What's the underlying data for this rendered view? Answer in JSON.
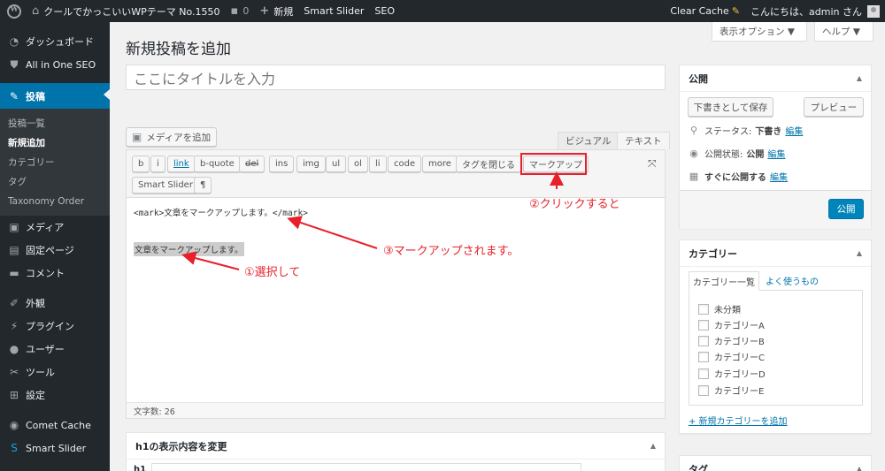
{
  "adminbar": {
    "site_name": "クールでかっこいいWPテーマ No.1550",
    "comments_count": "0",
    "new_label": "新規",
    "smart_slider": "Smart Slider",
    "seo": "SEO",
    "clear_cache": "Clear Cache",
    "greeting": "こんにちは、admin さん"
  },
  "sidebar": {
    "items": [
      {
        "label": "ダッシュボード",
        "icon": "dashboard-icon"
      },
      {
        "label": "All in One SEO",
        "icon": "shield-icon"
      },
      {
        "label": "投稿",
        "icon": "pin-icon"
      },
      {
        "label": "メディア",
        "icon": "media-icon"
      },
      {
        "label": "固定ページ",
        "icon": "page-icon"
      },
      {
        "label": "コメント",
        "icon": "comment-icon"
      },
      {
        "label": "外観",
        "icon": "brush-icon"
      },
      {
        "label": "プラグイン",
        "icon": "plug-icon"
      },
      {
        "label": "ユーザー",
        "icon": "user-icon"
      },
      {
        "label": "ツール",
        "icon": "wrench-icon"
      },
      {
        "label": "設定",
        "icon": "settings-icon"
      },
      {
        "label": "Comet Cache",
        "icon": "comet-icon"
      },
      {
        "label": "Smart Slider",
        "icon": "slider-icon"
      }
    ],
    "submenu": [
      "投稿一覧",
      "新規追加",
      "カテゴリー",
      "タグ",
      "Taxonomy Order"
    ]
  },
  "screen_options": "表示オプション ▼",
  "help": "ヘルプ ▼",
  "page_title": "新規投稿を追加",
  "title_placeholder": "ここにタイトルを入力",
  "editor": {
    "add_media": "メディアを追加",
    "tab_visual": "ビジュアル",
    "tab_text": "テキスト",
    "buttons": [
      "b",
      "i",
      "link",
      "b-quote",
      "del",
      "ins",
      "img",
      "ul",
      "ol",
      "li",
      "code",
      "more",
      "タグを閉じる",
      "マークアップ",
      "Smart Slider",
      "¶"
    ],
    "line1": "<mark>文章をマークアップします。</mark>",
    "line2": "文章をマークアップします。",
    "word_count": "文字数: 26"
  },
  "annotations": {
    "click": "②クリックすると",
    "marked": "③マークアップされます。",
    "select": "①選択して"
  },
  "h1_box_title": "h1の表示内容を変更",
  "h1_box_label": "h1",
  "publish": {
    "title": "公開",
    "save_draft": "下書きとして保存",
    "preview": "プレビュー",
    "status_label": "ステータス:",
    "status_value": "下書き",
    "visibility_label": "公開状態:",
    "visibility_value": "公開",
    "schedule": "すぐに公開する",
    "edit": "編集",
    "publish_button": "公開"
  },
  "category": {
    "title": "カテゴリー",
    "tab_all": "カテゴリー一覧",
    "tab_popular": "よく使うもの",
    "items": [
      "未分類",
      "カテゴリーA",
      "カテゴリーB",
      "カテゴリーC",
      "カテゴリーD",
      "カテゴリーE"
    ],
    "add_new": "+ 新規カテゴリーを追加"
  },
  "tag_box_title": "タグ",
  "colors": {
    "adminbar": "#23282d",
    "accent": "#0073aa",
    "annotation": "#e8202a"
  }
}
